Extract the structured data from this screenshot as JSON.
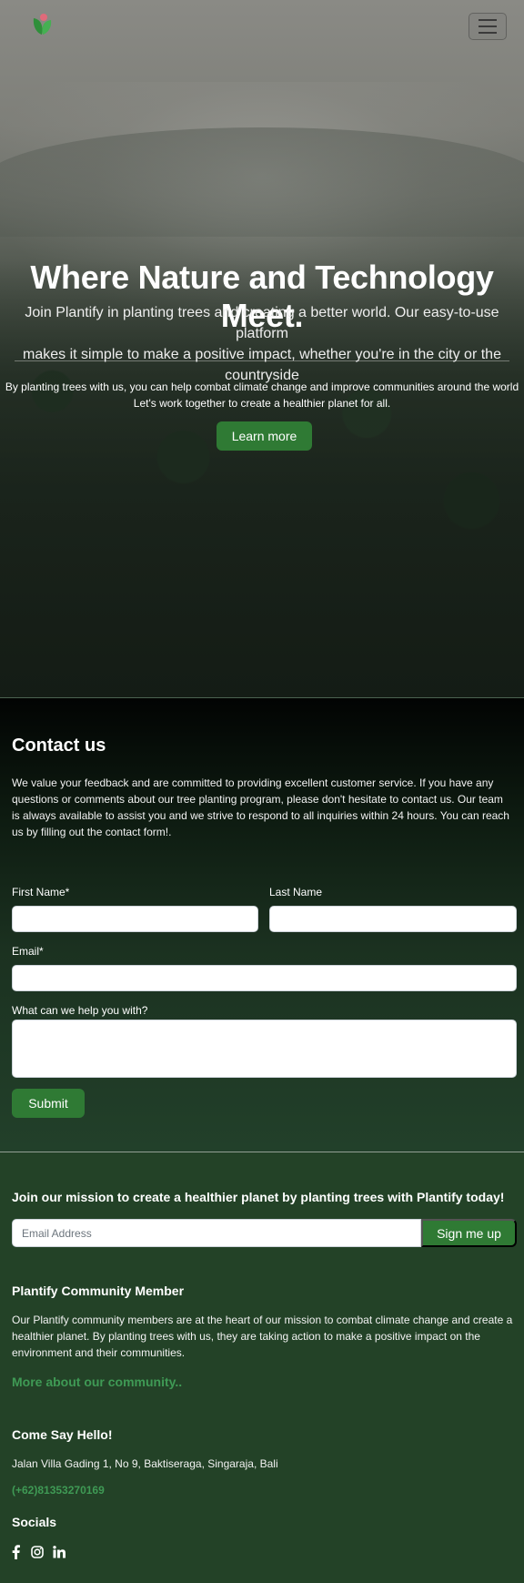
{
  "hero": {
    "title": "Where Nature and Technology Meet.",
    "subtitle_line1": "Join Plantify in planting trees and creating a better world. Our easy-to-use platform",
    "subtitle_line2": "makes it simple to make a positive impact, whether you're in the city or the countryside",
    "body_line1": "By planting trees with us, you can help combat climate change and improve communities around the world",
    "body_line2": "Let's work together to create a healthier planet for all.",
    "cta_label": "Learn more"
  },
  "nav": {
    "logo_icon": "plantify-leaf-logo",
    "menu_icon": "hamburger-menu-icon"
  },
  "contact": {
    "title": "Contact us",
    "description": "We value your feedback and are committed to providing excellent customer service. If you have any questions or comments about our tree planting program, please don't hesitate to contact us. Our team is always available to assist you and we strive to respond to all inquiries within 24 hours. You can reach us by filling out the contact form!.",
    "first_name_label": "First Name*",
    "first_name_value": "",
    "last_name_label": "Last Name",
    "last_name_value": "",
    "email_label": "Email*",
    "email_value": "",
    "message_label": "What can we help you with?",
    "message_value": "",
    "submit_label": "Submit"
  },
  "footer": {
    "newsletter_title": "Join our mission to create a healthier planet by planting trees with Plantify today!",
    "newsletter_placeholder": "Email Address",
    "newsletter_button": "Sign me up",
    "community_title": "Plantify Community Member",
    "community_text": "Our Plantify community members are at the heart of our mission to combat climate change and create a healthier planet. By planting trees with us, they are taking action to make a positive impact on the environment and their communities.",
    "community_link": "More about our community..",
    "hello_title": "Come Say Hello!",
    "address": "Jalan Villa Gading 1, No 9, Baktiseraga, Singaraja, Bali",
    "phone": "(+62)81353270169",
    "socials_title": "Socials",
    "socials": [
      "facebook-icon",
      "instagram-icon",
      "linkedin-icon"
    ]
  },
  "colors": {
    "accent_green": "#2f7a34",
    "link_green": "#3f9a55",
    "footer_bg": "#234227"
  }
}
